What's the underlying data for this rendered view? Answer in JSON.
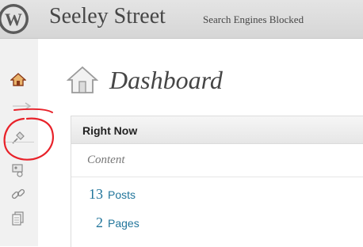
{
  "admin_bar": {
    "site_title": "Seeley Street",
    "notice": "Search Engines Blocked",
    "logo": "wordpress-logo"
  },
  "sidebar": {
    "items": [
      {
        "icon": "home-icon"
      },
      {
        "icon": "pin-icon"
      },
      {
        "icon": "media-icon"
      },
      {
        "icon": "link-icon"
      },
      {
        "icon": "pages-icon"
      }
    ]
  },
  "main": {
    "page_title": "Dashboard",
    "page_icon": "house-icon",
    "right_now": {
      "title": "Right Now",
      "section": "Content",
      "rows": [
        {
          "count": "13",
          "label": "Posts"
        },
        {
          "count": "2",
          "label": "Pages"
        }
      ]
    }
  },
  "colors": {
    "link": "#21759b",
    "annotation": "#e8222a"
  }
}
